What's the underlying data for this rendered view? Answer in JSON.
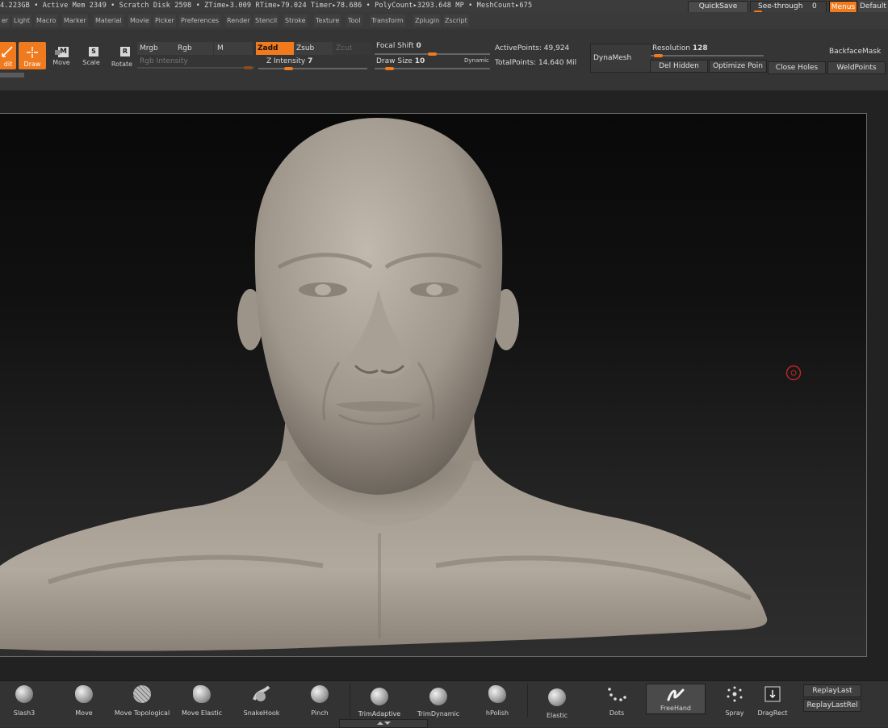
{
  "status": {
    "text": "4.223GB • Active Mem 2349 • Scratch Disk 2598 •  ZTime▸3.009 RTime▸79.024 Timer▸78.686 • PolyCount▸3293.648 MP  • MeshCount▸675",
    "quicksave": "QuickSave",
    "see_through_label": "See-through",
    "see_through_value": "0",
    "menus": "Menus",
    "default": "Default"
  },
  "menus": [
    "er",
    "Light",
    "Macro",
    "Marker",
    "Material",
    "Movie",
    "Picker",
    "Preferences",
    "Render",
    "Stencil",
    "Stroke",
    "Texture",
    "Tool",
    "Transform",
    "Zplugin",
    "Zscript"
  ],
  "toolbar": {
    "edit": "dit",
    "draw": "Draw",
    "move": "Move",
    "scale": "Scale",
    "rotate": "Rotate",
    "mrgb": "Mrgb",
    "rgb": "Rgb",
    "m": "M",
    "rgb_intensity": "Rgb Intensity",
    "zadd": "Zadd",
    "zsub": "Zsub",
    "zcut": "Zcut",
    "z_intensity_label": "Z Intensity",
    "z_intensity_value": "7",
    "focal_shift_label": "Focal Shift",
    "focal_shift_value": "0",
    "draw_size_label": "Draw Size",
    "draw_size_value": "10",
    "dynamic": "Dynamic",
    "active_points_label": "ActivePoints:",
    "active_points_value": "49,924",
    "total_points_label": "TotalPoints:",
    "total_points_value": "14.640 Mil",
    "dynamesh": "DynaMesh",
    "resolution_label": "Resolution",
    "resolution_value": "128",
    "del_hidden": "Del Hidden",
    "optimize_points": "Optimize Poin",
    "close_holes": "Close Holes",
    "backface_mask": "BackfaceMask",
    "weld_points": "WeldPoints"
  },
  "brushes": [
    "Slash3",
    "Move",
    "Move Topological",
    "Move Elastic",
    "SnakeHook",
    "Pinch",
    "TrimAdaptive",
    "TrimDynamic",
    "hPolish",
    "Elastic",
    "Dots",
    "FreeHand",
    "Spray",
    "DragRect"
  ],
  "replay": {
    "last": "ReplayLast",
    "last_rel": "ReplayLastRel"
  },
  "colors": {
    "accent": "#f07a1e",
    "cursor": "#c0262b",
    "clay": "#a39a90"
  }
}
